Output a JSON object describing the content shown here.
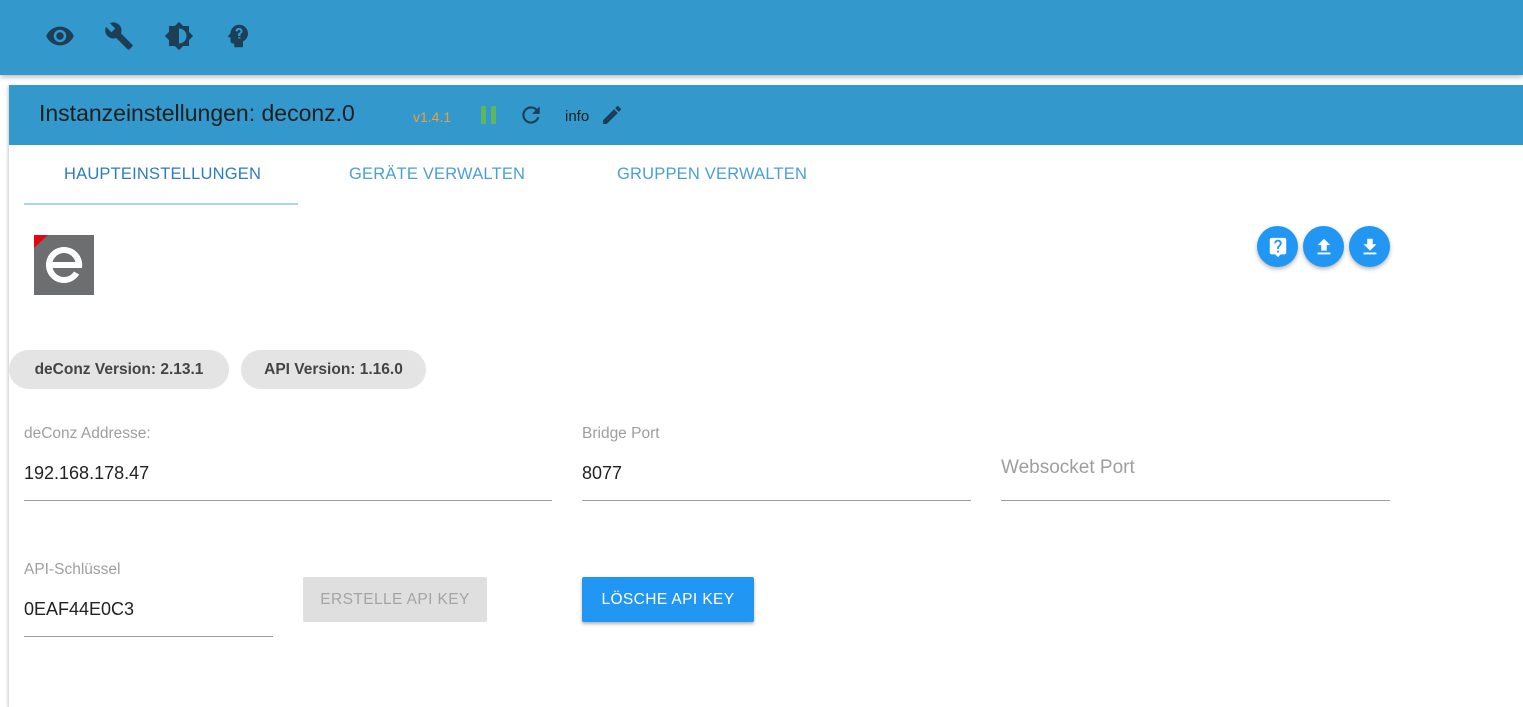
{
  "topbar": {
    "icons": [
      "eye-icon",
      "wrench-icon",
      "brightness-icon",
      "head-icon"
    ]
  },
  "header": {
    "title": "Instanzeinstellungen: deconz.0",
    "version": "v1.4.1",
    "info_label": "info"
  },
  "tabs": [
    {
      "label": "HAUPTEINSTELLUNGEN",
      "active": true
    },
    {
      "label": "GERÄTE VERWALTEN",
      "active": false
    },
    {
      "label": "GRUPPEN VERWALTEN",
      "active": false
    }
  ],
  "chips": {
    "deconz_version": "deConz Version: 2.13.1",
    "api_version": "API Version: 1.16.0"
  },
  "fields": {
    "address": {
      "label": "deConz Addresse:",
      "value": "192.168.178.47"
    },
    "bridge_port": {
      "label": "Bridge Port",
      "value": "8077"
    },
    "websocket_port": {
      "label": "Websocket Port",
      "value": ""
    },
    "api_key": {
      "label": "API-Schlüssel",
      "value": "0EAF44E0C3"
    }
  },
  "buttons": {
    "create_api_key": "ERSTELLE API KEY",
    "delete_api_key": "LÖSCHE API KEY"
  },
  "colors": {
    "header_blue": "#3399cc",
    "primary": "#2196f3",
    "version_orange": "#e8a23a",
    "running_green": "#5cb85c"
  }
}
